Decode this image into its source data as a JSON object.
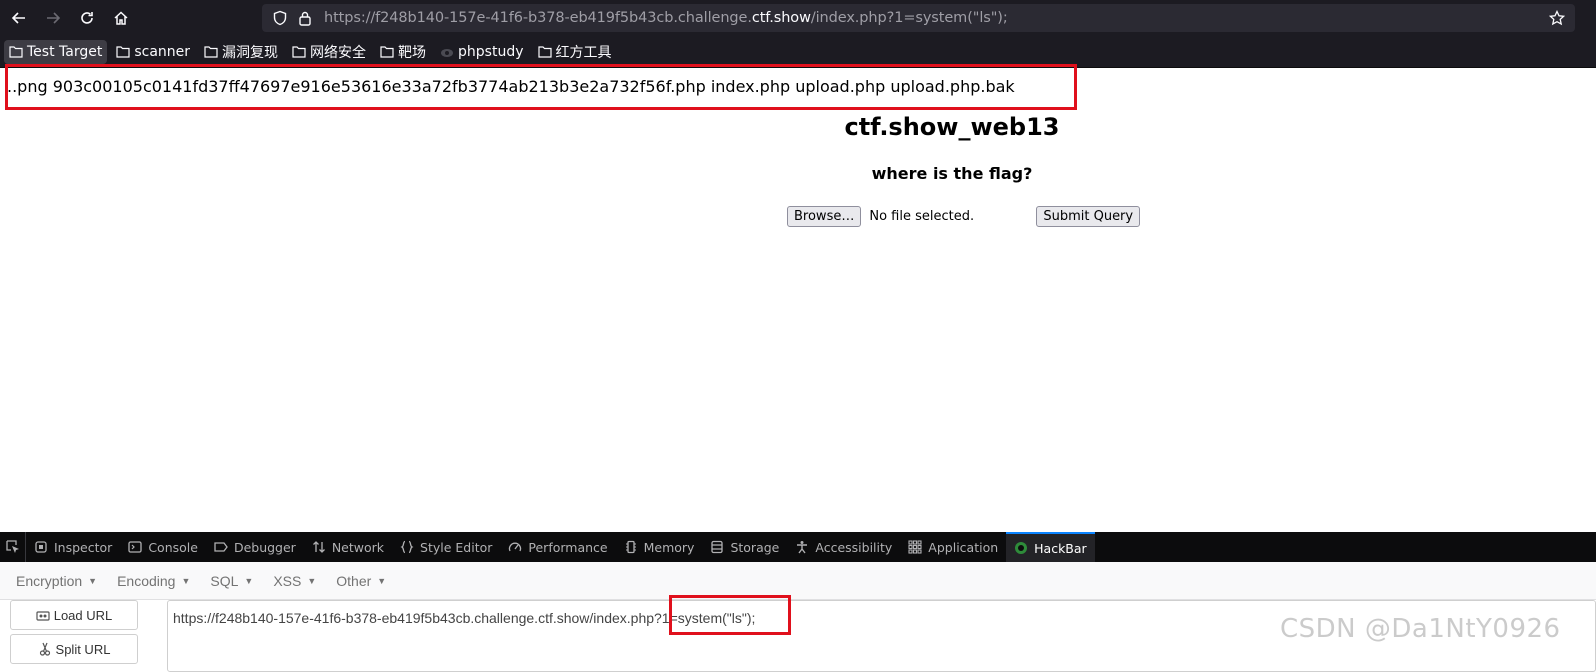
{
  "browser": {
    "url_prefix": "https://f248b140-157e-41f6-b378-eb419f5b43cb.challenge.",
    "url_host": "ctf.show",
    "url_suffix": "/index.php?1=system(\"ls\");"
  },
  "bookmarks": [
    {
      "label": "Test Target",
      "icon": "folder-icon"
    },
    {
      "label": "scanner",
      "icon": "folder-icon"
    },
    {
      "label": "漏洞复现",
      "icon": "folder-icon"
    },
    {
      "label": "网络安全",
      "icon": "folder-icon"
    },
    {
      "label": "靶场",
      "icon": "folder-icon"
    },
    {
      "label": "phpstudy",
      "icon": "phpstudy-icon"
    },
    {
      "label": "红方工具",
      "icon": "folder-icon"
    }
  ],
  "page": {
    "listing": "..png 903c00105c0141fd37ff47697e916e53616e33a72fb3774ab213b3e2a732f56f.php index.php upload.php upload.php.bak",
    "title": "ctf.show_web13",
    "subtitle": "where is the flag?",
    "browse_label": "Browse…",
    "file_status": "No file selected.",
    "submit_label": "Submit Query"
  },
  "devtools": {
    "tabs": [
      "Inspector",
      "Console",
      "Debugger",
      "Network",
      "Style Editor",
      "Performance",
      "Memory",
      "Storage",
      "Accessibility",
      "Application",
      "HackBar"
    ],
    "selected_tab": "HackBar"
  },
  "hackbar": {
    "menu": [
      "Encryption",
      "Encoding",
      "SQL",
      "XSS",
      "Other"
    ],
    "load_url": "Load URL",
    "split_url": "Split URL",
    "url_value": "https://f248b140-157e-41f6-b378-eb419f5b43cb.challenge.ctf.show/index.php?1=system(\"ls\");"
  },
  "watermark": "CSDN @Da1NtY0926",
  "colors": {
    "highlight_box": "#e0101c",
    "toolbar_bg": "#1c1b22",
    "devtools_bg": "#0c0c0d"
  }
}
